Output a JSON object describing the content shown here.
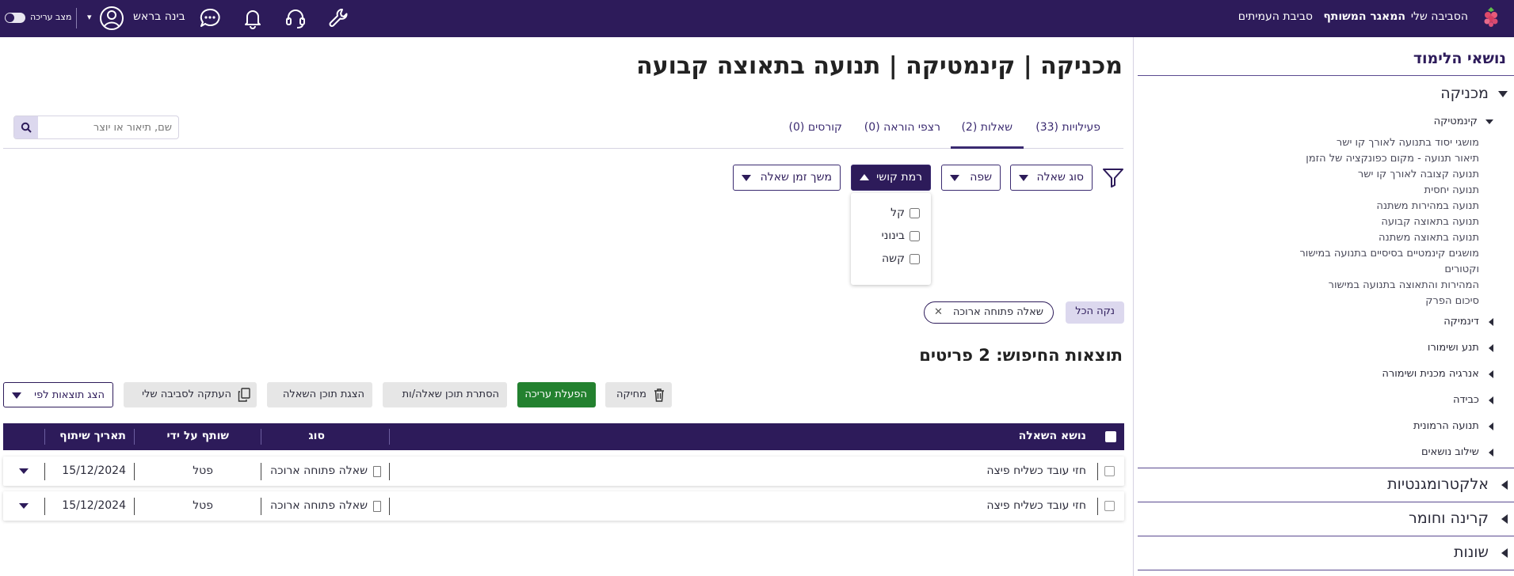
{
  "topbar": {
    "nav": {
      "my_env": "הסביבה שלי",
      "shared_repo": "המאגר המשותף",
      "partners_env": "סביבת העמיתים"
    },
    "user_name": "בינה בראש",
    "edit_mode_label": "מצב עריכה",
    "icons": [
      "wrench-icon",
      "headset-icon",
      "bell-icon",
      "chat-icon",
      "user-avatar-icon"
    ]
  },
  "sidebar": {
    "title": "נושאי הלימוד",
    "topic_mechanics": "מכניקה",
    "sub_kinematics": "קינמטיקה",
    "kinematics_items": [
      "מושגי יסוד בתנועה לאורך קו ישר",
      "תיאור תנועה - מקום כפונקציה של הזמן",
      "תנועה קצובה לאורך קו ישר",
      "תנועה יחסית",
      "תנועה במהירות משתנה",
      "תנועה בתאוצה קבועה",
      "תנועה בתאוצה משתנה",
      "מושגים קינמטיים בסיסיים בתנועה במישור",
      "וקטורים",
      "המהירות והתאוצה בתנועה במישור",
      "סיכום הפרק"
    ],
    "mechanics_subs": [
      "דינמיקה",
      "תנע ושימורו",
      "אנרגיה מכנית ושימורה",
      "כבידה",
      "תנועה הרמונית",
      "שילוב נושאים"
    ],
    "other_topics": [
      "אלקטרומגנטיות",
      "קרינה וחומר",
      "שונות"
    ]
  },
  "main": {
    "page_title": "מכניקה | קינמטיקה | תנועה בתאוצה קבועה",
    "search_placeholder": "שם, תיאור או יוצר",
    "tabs": [
      {
        "label": "פעילויות (33)",
        "active": false
      },
      {
        "label": "שאלות (2)",
        "active": true
      },
      {
        "label": "רצפי הוראה (0)",
        "active": false
      },
      {
        "label": "קורסים (0)",
        "active": false
      }
    ],
    "filters": {
      "question_type": "סוג שאלה",
      "language": "שפה",
      "difficulty": "רמת קושי",
      "duration": "משך זמן שאלה"
    },
    "difficulty_options": [
      "קל",
      "בינוני",
      "קשה"
    ],
    "clear_all": "נקה הכל",
    "active_filter_chip": "שאלה פתוחה ארוכה",
    "results_title": "תוצאות החיפוש: 2 פריטים",
    "actions": {
      "delete": "מחיקה",
      "enable_edit": "הפעלת עריכה",
      "hide_content": "הסתרת תוכן שאלה/ות",
      "show_content": "הצגת תוכן השאלה",
      "copy_to_env": "העתקה לסביבה שלי",
      "show_by": "הצג תוצאות לפי"
    },
    "table": {
      "columns": [
        "נושא השאלה",
        "סוג",
        "שותף על ידי",
        "תאריך שיתוף"
      ],
      "rows": [
        {
          "subject": "חזי עובד כשליח פיצה",
          "type": "שאלה פתוחה ארוכה",
          "shared_by": "פטל",
          "date": "15/12/2024"
        },
        {
          "subject": "חזי עובד כשליח פיצה",
          "type": "שאלה פתוחה ארוכה",
          "shared_by": "פטל",
          "date": "15/12/2024"
        }
      ]
    }
  },
  "colors": {
    "primary": "#2d1b5a",
    "accent_green": "#23812f",
    "chip_bg": "#dcd8ee"
  }
}
